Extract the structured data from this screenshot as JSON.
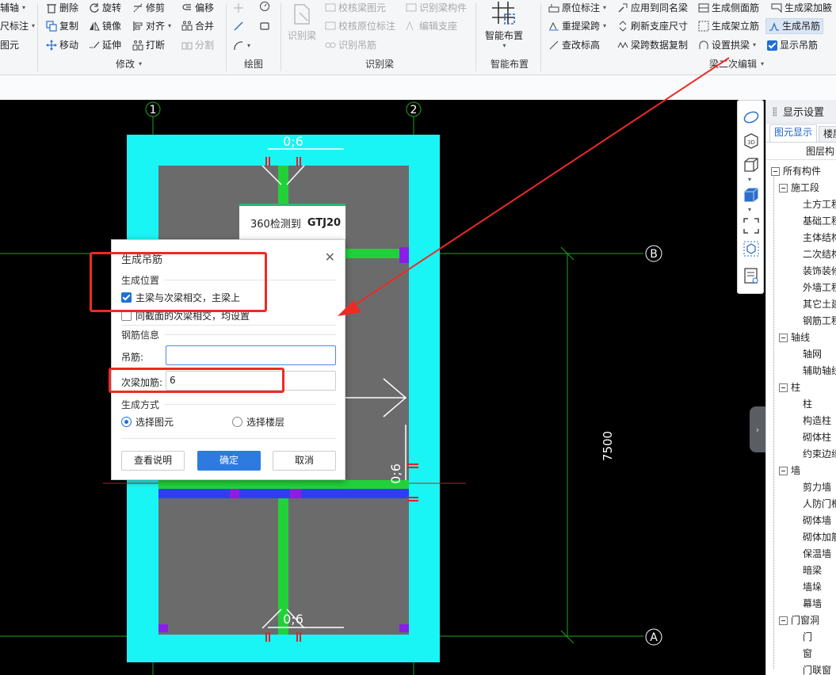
{
  "ribbon": {
    "axis_aux": "辅轴",
    "dim_mark": "尺标注",
    "draw_elem": "图元",
    "delete": "删除",
    "rotate": "旋转",
    "trim": "修剪",
    "offset": "偏移",
    "copy": "复制",
    "mirror": "镜像",
    "align": "对齐",
    "merge": "合并",
    "move": "移动",
    "extend": "延伸",
    "break": "打断",
    "split": "分割",
    "group_modify": "修改",
    "group_draw": "绘图",
    "identify_beam": "识别梁",
    "check_beam_elem": "校核梁图元",
    "check_origin_mark": "校核原位标注",
    "identify_hanger": "识别吊筋",
    "identify_beam_comp": "识别梁构件",
    "edit_support": "编辑支座",
    "group_identify_beam": "识别梁",
    "smart_layout": "智能布置",
    "group_smart_layout": "智能布置",
    "origin_mark": "原位标注",
    "apply_same_beam": "应用到同名梁",
    "gen_side_rebar": "生成侧面筋",
    "gen_beam_haunch": "生成梁加腋",
    "re_extract_span": "重提梁跨",
    "refresh_support": "刷新支座尺寸",
    "gen_stirrup_column": "生成架立筋",
    "gen_hanger": "生成吊筋",
    "check_elevation": "查改标高",
    "copy_span_data": "梁跨数据复制",
    "set_arch": "设置拱梁",
    "show_hanger": "显示吊筋",
    "group_beam_secondary": "梁二次编辑"
  },
  "canvas": {
    "axis_1": "1",
    "axis_2": "2",
    "axis_A": "A",
    "axis_B": "B",
    "dim_7500": "7500",
    "label_top": "0;6",
    "label_side": "0;6",
    "label_bottom": "0;6"
  },
  "toast": {
    "text": "360检测到",
    "bold": "GTJ20"
  },
  "dialog": {
    "title": "生成吊筋",
    "section_position": "生成位置",
    "opt_main_secondary": "主梁与次梁相交，主梁上",
    "opt_same_section": "同截面的次梁相交，均设置",
    "section_rebar": "钢筋信息",
    "hanger_label": "吊筋:",
    "hanger_value": "",
    "secondary_label": "次梁加筋:",
    "secondary_value": "6",
    "section_method": "生成方式",
    "radio_select_elem": "选择图元",
    "radio_select_floor": "选择楼层",
    "btn_help": "查看说明",
    "btn_ok": "确定",
    "btn_cancel": "取消"
  },
  "panel": {
    "title": "显示设置",
    "tab_elem": "图元显示",
    "tab_floor": "楼层",
    "col_header": "图层构",
    "tree": [
      {
        "label": "所有构件",
        "level": 0,
        "box": true
      },
      {
        "label": "施工段",
        "level": 1,
        "box": true
      },
      {
        "label": "土方工程",
        "level": 2,
        "box": false
      },
      {
        "label": "基础工程",
        "level": 2,
        "box": false
      },
      {
        "label": "主体结构",
        "level": 2,
        "box": false
      },
      {
        "label": "二次结构",
        "level": 2,
        "box": false
      },
      {
        "label": "装饰装修",
        "level": 2,
        "box": false
      },
      {
        "label": "外墙工程",
        "level": 2,
        "box": false
      },
      {
        "label": "其它土建",
        "level": 2,
        "box": false
      },
      {
        "label": "钢筋工程",
        "level": 2,
        "box": false
      },
      {
        "label": "轴线",
        "level": 1,
        "box": true
      },
      {
        "label": "轴网",
        "level": 2,
        "box": false
      },
      {
        "label": "辅助轴线",
        "level": 2,
        "box": false
      },
      {
        "label": "柱",
        "level": 1,
        "box": true
      },
      {
        "label": "柱",
        "level": 2,
        "box": false
      },
      {
        "label": "构造柱",
        "level": 2,
        "box": false
      },
      {
        "label": "砌体柱",
        "level": 2,
        "box": false
      },
      {
        "label": "约束边缘",
        "level": 2,
        "box": false
      },
      {
        "label": "墙",
        "level": 1,
        "box": true
      },
      {
        "label": "剪力墙",
        "level": 2,
        "box": false
      },
      {
        "label": "人防门框",
        "level": 2,
        "box": false
      },
      {
        "label": "砌体墙",
        "level": 2,
        "box": false
      },
      {
        "label": "砌体加筋",
        "level": 2,
        "box": false
      },
      {
        "label": "保温墙",
        "level": 2,
        "box": false
      },
      {
        "label": "暗梁",
        "level": 2,
        "box": false
      },
      {
        "label": "墙垛",
        "level": 2,
        "box": false
      },
      {
        "label": "幕墙",
        "level": 2,
        "box": false
      },
      {
        "label": "门窗洞",
        "level": 1,
        "box": true
      },
      {
        "label": "门",
        "level": 2,
        "box": false
      },
      {
        "label": "窗",
        "level": 2,
        "box": false
      },
      {
        "label": "门联窗",
        "level": 2,
        "box": false
      }
    ]
  },
  "colors": {
    "slab_cyan": "#19f5f5",
    "slab_gray": "#6b6b6b",
    "beam_green": "#22d13a",
    "beam_blue": "#2e3ef5",
    "marker_purple": "#8a1ee8",
    "annotation_red": "#ee2a24",
    "grid_green": "#1fa51f",
    "primary_blue": "#2d7be0"
  }
}
